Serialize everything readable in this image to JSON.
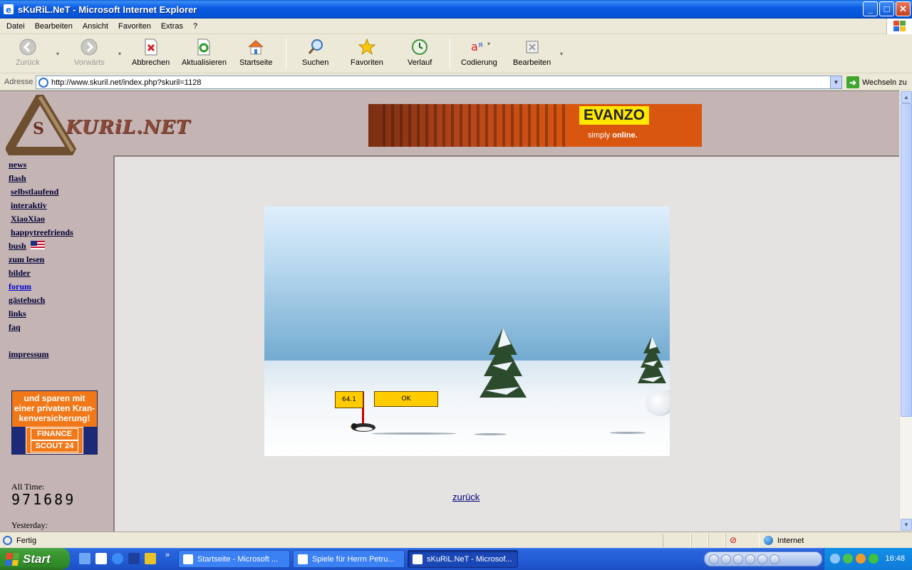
{
  "window": {
    "title": "sKuRiL.NeT - Microsoft Internet Explorer",
    "controls": {
      "minimize": "_",
      "maximize": "□",
      "close": "✕"
    }
  },
  "menu": [
    "Datei",
    "Bearbeiten",
    "Ansicht",
    "Favoriten",
    "Extras",
    "?"
  ],
  "toolbar": {
    "back": "Zurück",
    "forward": "Vorwärts",
    "stop": "Abbrechen",
    "refresh": "Aktualisieren",
    "home": "Startseite",
    "search": "Suchen",
    "favorites": "Favoriten",
    "history": "Verlauf",
    "encoding": "Codierung",
    "edit": "Bearbeiten"
  },
  "address": {
    "label": "Adresse",
    "url": "http://www.skuril.net/index.php?skuril=1128",
    "go": "Wechseln zu"
  },
  "site": {
    "logo_text": "KURiL.NET",
    "logo_letter": "S",
    "banner": {
      "brand": "EVANZO",
      "tag_1": "simply",
      "tag_2": "online."
    },
    "nav": {
      "news": "news",
      "flash": "flash",
      "selbstlaufend": "selbstlaufend",
      "interaktiv": "interaktiv",
      "xiaoxiao": "XiaoXiao",
      "happytreefriends": "happytreefriends",
      "bush": "bush",
      "zum_lesen": "zum lesen",
      "bilder": "bilder",
      "forum": "forum",
      "gaestebuch": "gästebuch",
      "links": "links",
      "faq": "faq",
      "impressum": "impressum"
    },
    "ad": {
      "text_1": "und sparen mit",
      "text_2": "einer privaten Kran-",
      "text_3": "kenversicherung!",
      "logo_1": "FINANCE",
      "logo_2": "SCOUT 24"
    },
    "counter": {
      "all_time_label": "All Time:",
      "all_time_value": "971689",
      "yesterday_label": "Yesterday:"
    },
    "game": {
      "score": "64.1",
      "ok_button": "OK"
    },
    "back_link": "zurück"
  },
  "status": {
    "text": "Fertig",
    "zone": "Internet"
  },
  "taskbar": {
    "start": "Start",
    "overflow": "»",
    "tasks": [
      "Startseite - Microsoft ...",
      "Spiele für Herrn Petru...",
      "sKuRiL.NeT - Microsof..."
    ],
    "time": "16:48"
  },
  "colors": {
    "titlebar": "#0653d6",
    "page_bg": "#c4b4b4",
    "content_bg": "#e5e3e1",
    "banner_brand": "#ffe800",
    "ad_orange": "#f07818",
    "game_button": "#ffcc00"
  }
}
